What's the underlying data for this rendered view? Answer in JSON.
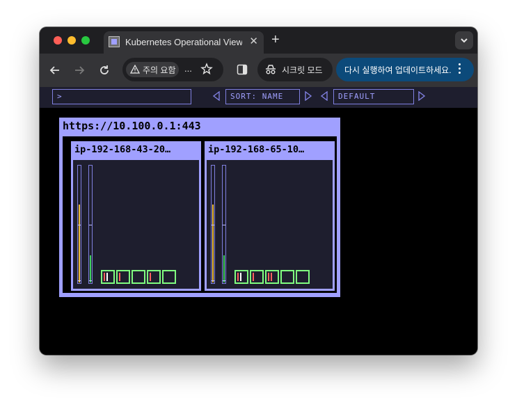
{
  "browser": {
    "tab": {
      "title": "Kubernetes Operational View",
      "close_glyph": "✕"
    },
    "new_tab_glyph": "+",
    "security_chip": "주의 요함",
    "url_ellipsis": "...",
    "incognito_label": "시크릿 모드",
    "update_label": "다시 실행하여 업데이트하세요."
  },
  "app": {
    "filter_value": ">",
    "sort_label": "SORT: NAME",
    "theme_label": "DEFAULT",
    "cluster": {
      "url": "https://10.100.0.1:443",
      "nodes": [
        {
          "name": "ip-192-168-43-20…",
          "cpu_usage": 0.66,
          "memory_usage": 0.23,
          "pods": [
            {
              "status_colors": [
                "#ff6060",
                "#ffffff"
              ]
            },
            {
              "status_colors": [
                "#ff6060"
              ]
            },
            {
              "status_colors": []
            },
            {
              "status_colors": [
                "#ff6060"
              ]
            },
            {
              "status_colors": []
            }
          ]
        },
        {
          "name": "ip-192-168-65-10…",
          "cpu_usage": 0.66,
          "memory_usage": 0.23,
          "pods": [
            {
              "status_colors": [
                "#ff6060",
                "#ffffff"
              ]
            },
            {
              "status_colors": [
                "#ff6060"
              ]
            },
            {
              "status_colors": [
                "#ff6060",
                "#ff6060"
              ]
            },
            {
              "status_colors": []
            },
            {
              "status_colors": []
            }
          ]
        }
      ]
    }
  },
  "colors": {
    "accent": "#a0a0ff",
    "cpu": "#f0c040",
    "memory": "#40d060",
    "pod_ok": "#80ff80",
    "update_bg": "#0c4a7a"
  }
}
